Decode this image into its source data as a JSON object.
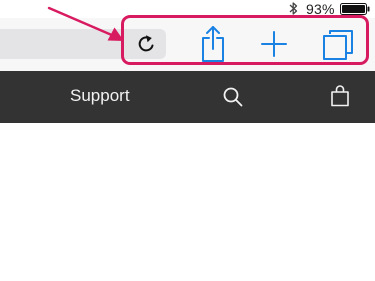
{
  "status_bar": {
    "battery_percent": "93%",
    "battery_level": 0.93,
    "icons": [
      "bluetooth-icon",
      "battery-icon"
    ]
  },
  "toolbar": {
    "buttons": [
      {
        "name": "reload-button",
        "icon": "reload-icon"
      },
      {
        "name": "share-button",
        "icon": "share-icon"
      },
      {
        "name": "new-tab-button",
        "icon": "plus-icon"
      },
      {
        "name": "tabs-button",
        "icon": "tabs-icon"
      }
    ],
    "accent_color": "#1a82e2"
  },
  "annotation": {
    "color": "#d81b60",
    "elements": [
      "arrow",
      "highlight-box"
    ]
  },
  "site_nav": {
    "background": "#333333",
    "link_label": "Support",
    "icons": [
      "search-icon",
      "shopping-bag-icon"
    ]
  }
}
